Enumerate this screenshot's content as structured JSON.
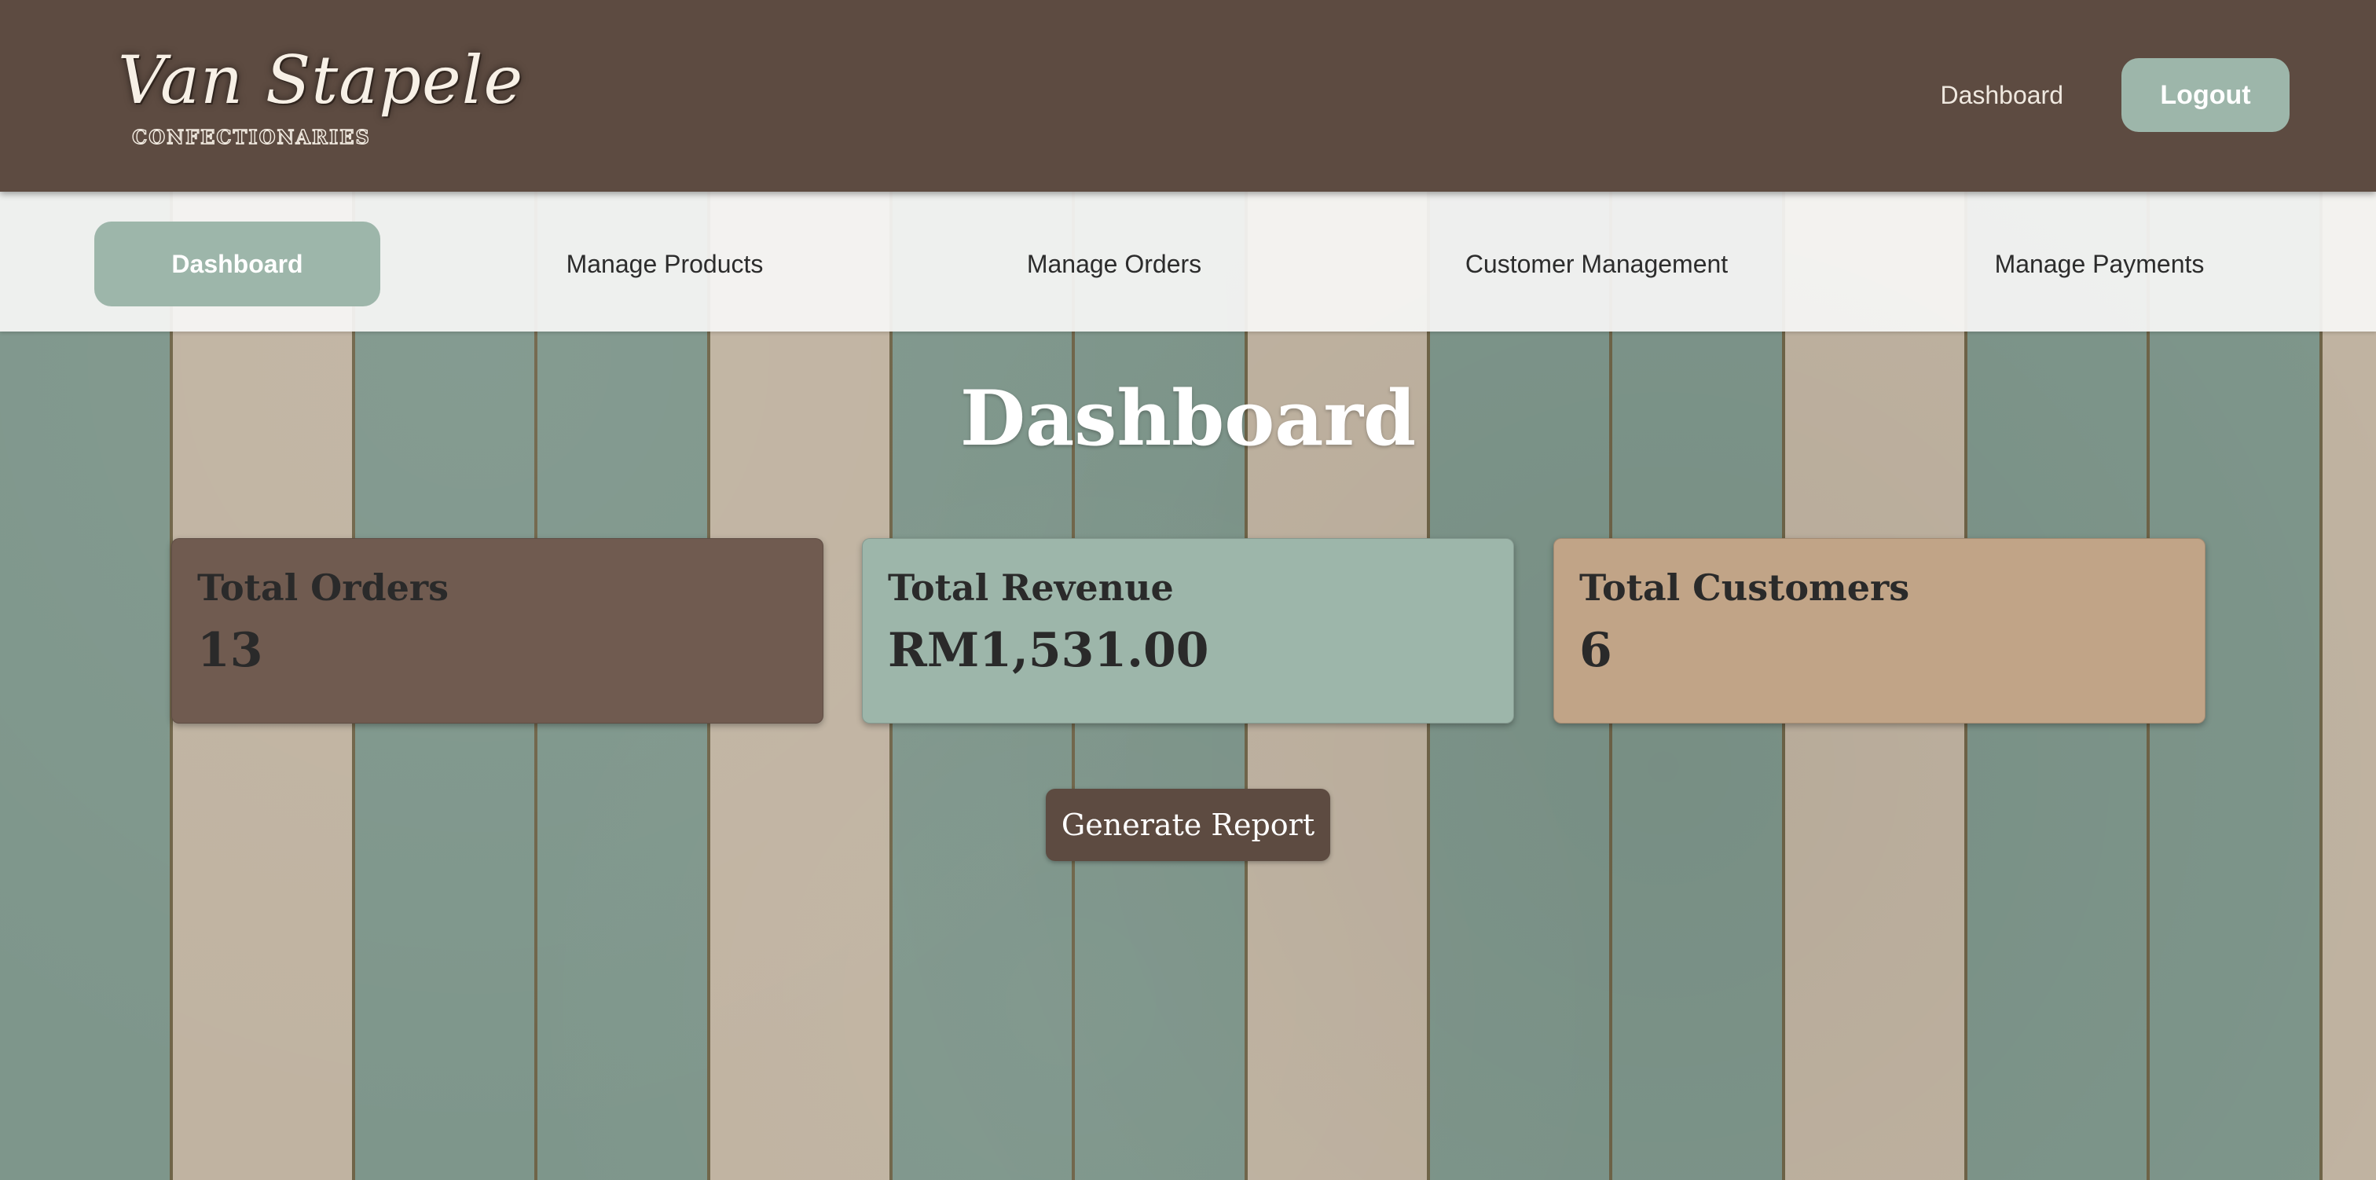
{
  "brand": {
    "name": "Van Stapele",
    "tagline": "CONFECTIONARIES"
  },
  "header": {
    "dashboard_link": "Dashboard",
    "logout_label": "Logout"
  },
  "subnav": {
    "items": [
      {
        "label": "Dashboard",
        "active": true
      },
      {
        "label": "Manage Products",
        "active": false
      },
      {
        "label": "Manage Orders",
        "active": false
      },
      {
        "label": "Customer Management",
        "active": false
      },
      {
        "label": "Manage Payments",
        "active": false
      }
    ]
  },
  "main": {
    "title": "Dashboard",
    "cards": [
      {
        "label": "Total Orders",
        "value": "13"
      },
      {
        "label": "Total Revenue",
        "value": "RM1,531.00"
      },
      {
        "label": "Total Customers",
        "value": "6"
      }
    ],
    "report_button": "Generate Report"
  },
  "colors": {
    "header_bg": "#5d4b41",
    "accent_sage": "#9db6aa",
    "orders_card": "#705b50",
    "customers_card": "#c1a487",
    "stripe_green": "#7e968b",
    "stripe_beige": "#c0b3a1"
  }
}
